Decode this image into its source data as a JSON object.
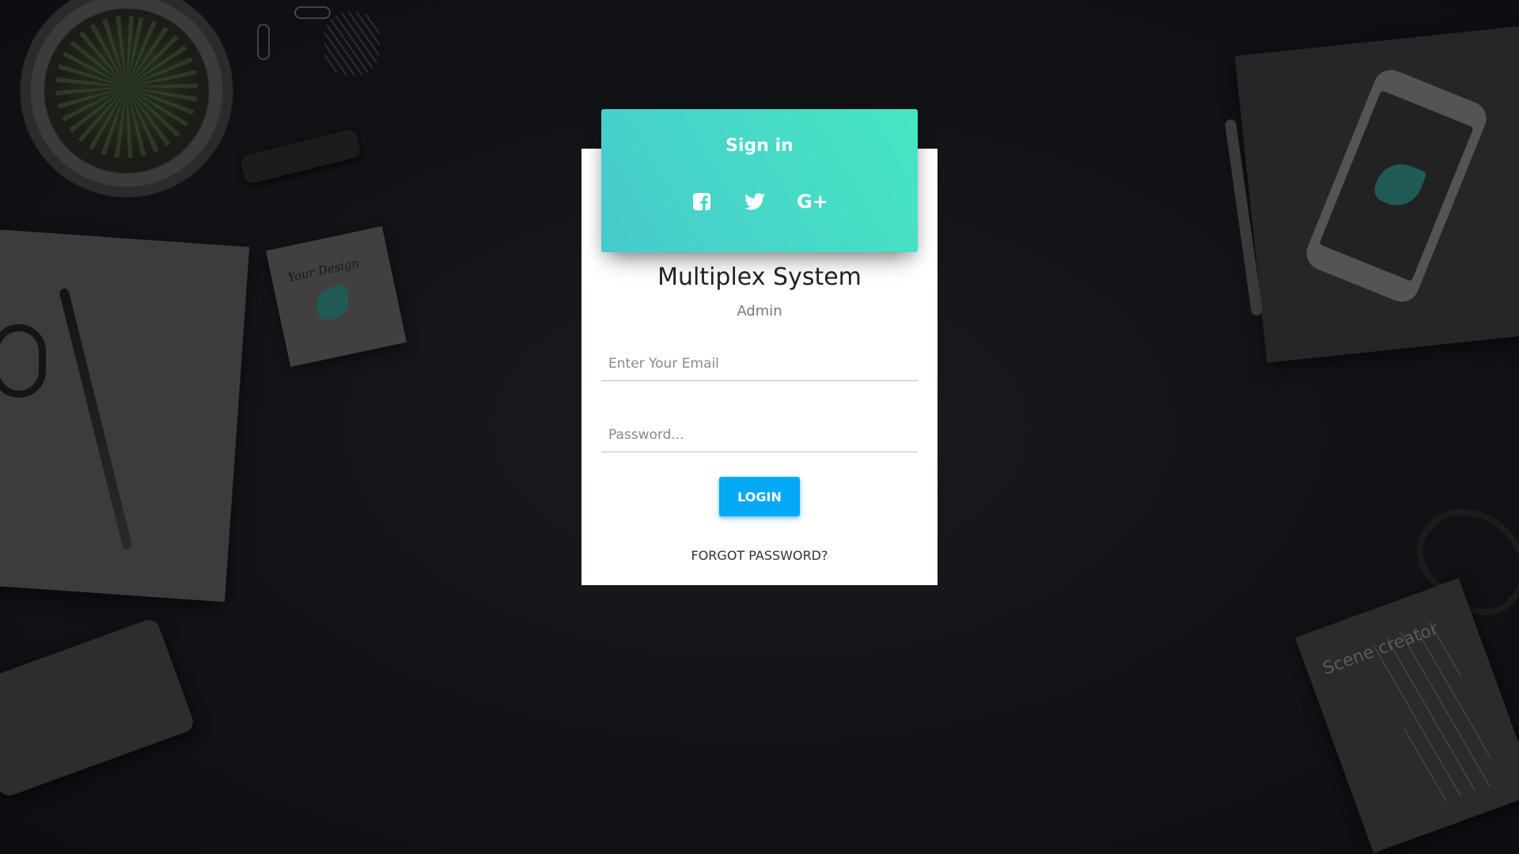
{
  "background": {
    "sticky_note_text": "Your Design",
    "book_title": "Scene creator"
  },
  "login": {
    "header_title": "Sign in",
    "social": [
      {
        "name": "facebook-icon"
      },
      {
        "name": "twitter-icon"
      },
      {
        "name": "google-plus-icon",
        "glyph": "G+"
      }
    ],
    "header_gradient": [
      "#47cacd",
      "#47e6c2"
    ],
    "app_title": "Multiplex System",
    "app_subtitle": "Admin",
    "email": {
      "placeholder": "Enter Your Email",
      "value": ""
    },
    "password": {
      "placeholder": "Password...",
      "value": ""
    },
    "login_button": "LOGIN",
    "login_button_color": "#03a9f4",
    "forgot_password": "FORGOT PASSWORD?"
  }
}
